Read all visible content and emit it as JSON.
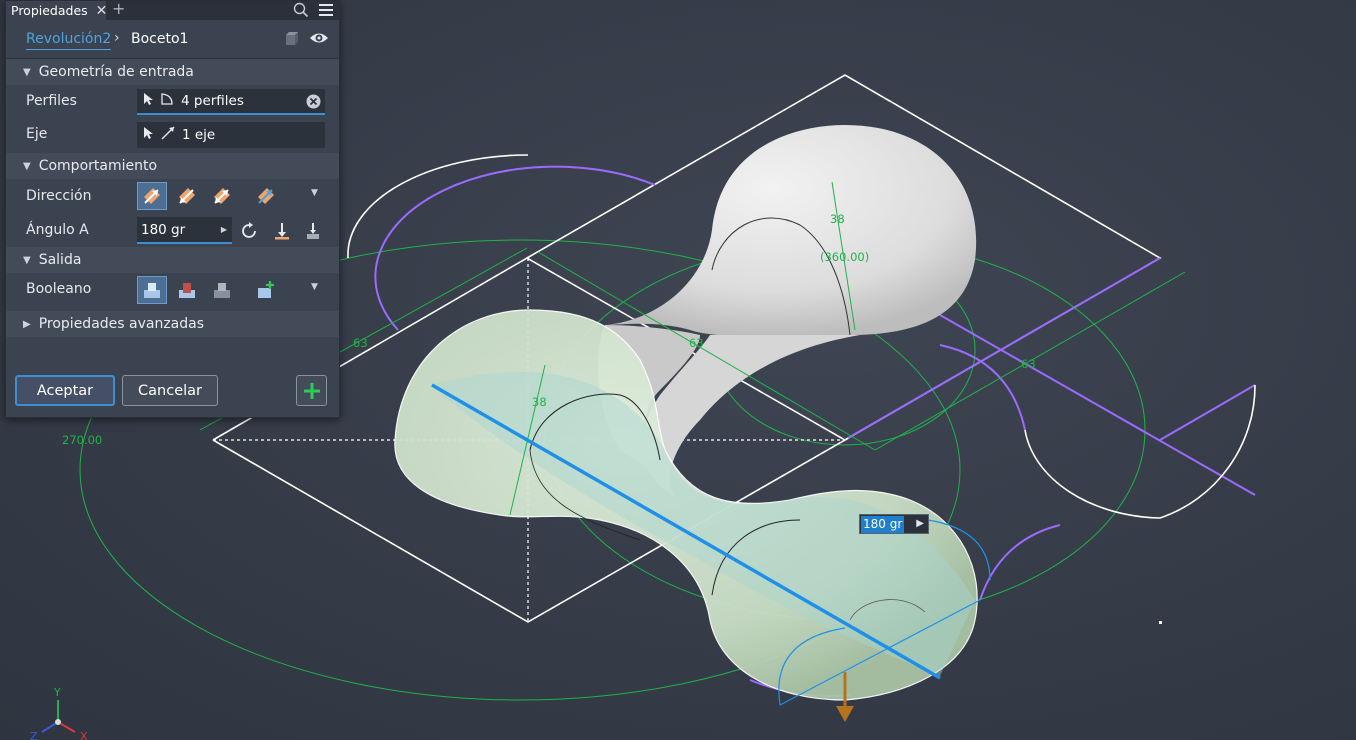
{
  "panel": {
    "tab_title": "Propiedades",
    "tab_close": "✕",
    "tab_add": "+",
    "breadcrumb": {
      "feature": "Revolución2",
      "separator": "›",
      "sketch": "Boceto1"
    },
    "sections": {
      "input": "Geometría de entrada",
      "behavior": "Comportamiento",
      "output": "Salida",
      "advanced": "Propiedades avanzadas"
    },
    "labels": {
      "profiles": "Perfiles",
      "axis": "Eje",
      "direction": "Dirección",
      "angle_a": "Ángulo A",
      "boolean": "Booleano"
    },
    "values": {
      "profiles": "4 perfiles",
      "axis": "1 eje",
      "angle_a": "180 gr"
    },
    "buttons": {
      "ok": "Aceptar",
      "cancel": "Cancelar"
    },
    "accent_color": "#3e8fd1"
  },
  "viewport": {
    "dimensions": {
      "d63_left": "63",
      "d63_mid": "63",
      "d63_right": "63",
      "d38_top": "38",
      "d38_left": "38",
      "d360": "(360.00)",
      "d270": "270.00"
    },
    "value_box": "180 gr",
    "dimension_color": "#1fb34a",
    "profile_color": "#9b6bff",
    "axis_color": "#1e90e8",
    "axes": {
      "y": "Y",
      "x": "X",
      "z": "Z"
    }
  }
}
